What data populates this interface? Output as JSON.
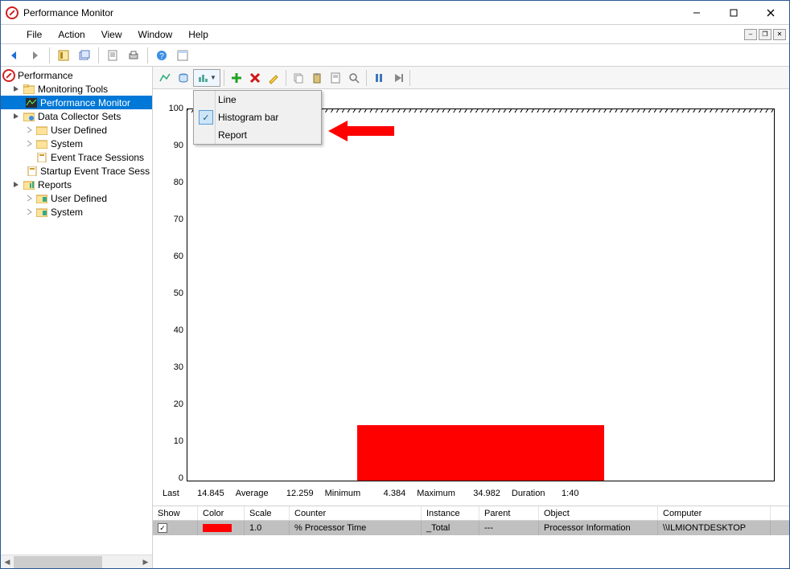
{
  "window": {
    "title": "Performance Monitor"
  },
  "menubar": {
    "items": [
      "File",
      "Action",
      "View",
      "Window",
      "Help"
    ]
  },
  "tree": {
    "root": "Performance",
    "monitoring_tools": "Monitoring Tools",
    "perfmon": "Performance Monitor",
    "dcs": "Data Collector Sets",
    "user_defined": "User Defined",
    "system": "System",
    "ets": "Event Trace Sessions",
    "startup_ets": "Startup Event Trace Sess",
    "reports": "Reports"
  },
  "dropdown": {
    "items": [
      "Line",
      "Histogram bar",
      "Report"
    ],
    "selected_index": 1
  },
  "chart_data": {
    "type": "bar",
    "categories": [
      "% Processor Time"
    ],
    "values": [
      14.845
    ],
    "ymin": 0,
    "ymax": 100,
    "yticks": [
      0,
      10,
      20,
      30,
      40,
      50,
      60,
      70,
      80,
      90,
      100
    ],
    "bar_color": "#ff0000"
  },
  "stats": {
    "last_label": "Last",
    "last_value": "14.845",
    "average_label": "Average",
    "average_value": "12.259",
    "minimum_label": "Minimum",
    "minimum_value": "4.384",
    "maximum_label": "Maximum",
    "maximum_value": "34.982",
    "duration_label": "Duration",
    "duration_value": "1:40"
  },
  "counter_table": {
    "headers": {
      "show": "Show",
      "color": "Color",
      "scale": "Scale",
      "counter": "Counter",
      "instance": "Instance",
      "parent": "Parent",
      "object": "Object",
      "computer": "Computer"
    },
    "row": {
      "show": true,
      "color": "#ff0000",
      "scale": "1.0",
      "counter": "% Processor Time",
      "instance": "_Total",
      "parent": "---",
      "object": "Processor Information",
      "computer": "\\\\ILMIONTDESKTOP"
    }
  },
  "col_widths": {
    "show": 56,
    "color": 58,
    "scale": 56,
    "counter": 164,
    "instance": 72,
    "parent": 74,
    "object": 148,
    "computer": 140
  },
  "icons": {
    "plus_color": "#23a123",
    "x_color": "#d01616",
    "pencil_color": "#e2a100"
  }
}
